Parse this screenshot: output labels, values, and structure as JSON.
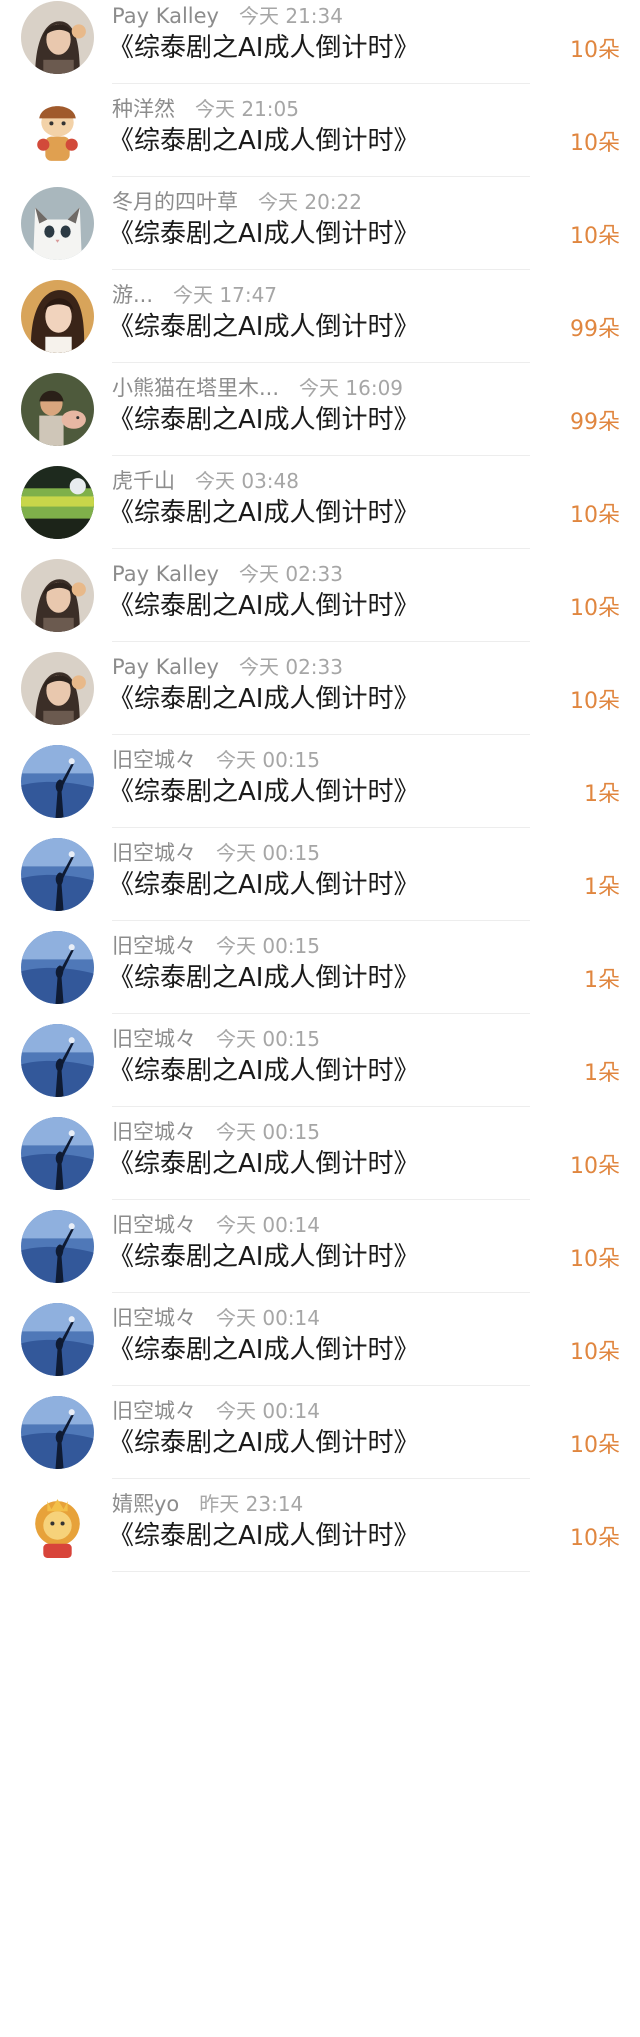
{
  "gift_list": {
    "items": [
      {
        "user": "Pay Kalley",
        "time": "今天 21:34",
        "title": "《综泰剧之AI成人倒计时》",
        "gift": "10朵",
        "avatar_icon": "avatar-girl-icon"
      },
      {
        "user": "种洋然",
        "time": "今天 21:05",
        "title": "《综泰剧之AI成人倒计时》",
        "gift": "10朵",
        "avatar_icon": "avatar-cartoon-icon"
      },
      {
        "user": "冬月的四叶草",
        "time": "今天 20:22",
        "title": "《综泰剧之AI成人倒计时》",
        "gift": "10朵",
        "avatar_icon": "avatar-cat-icon"
      },
      {
        "user": "游...",
        "time": "今天 17:47",
        "title": "《综泰剧之AI成人倒计时》",
        "gift": "99朵",
        "avatar_icon": "avatar-woman-icon"
      },
      {
        "user": "小熊猫在塔里木...",
        "time": "今天 16:09",
        "title": "《综泰剧之AI成人倒计时》",
        "gift": "99朵",
        "avatar_icon": "avatar-child-icon"
      },
      {
        "user": "虎千山",
        "time": "今天 03:48",
        "title": "《综泰剧之AI成人倒计时》",
        "gift": "10朵",
        "avatar_icon": "avatar-landscape-icon"
      },
      {
        "user": "Pay Kalley",
        "time": "今天 02:33",
        "title": "《综泰剧之AI成人倒计时》",
        "gift": "10朵",
        "avatar_icon": "avatar-girl-icon"
      },
      {
        "user": "Pay Kalley",
        "time": "今天 02:33",
        "title": "《综泰剧之AI成人倒计时》",
        "gift": "10朵",
        "avatar_icon": "avatar-girl-icon"
      },
      {
        "user": "旧空城々",
        "time": "今天 00:15",
        "title": "《综泰剧之AI成人倒计时》",
        "gift": "1朵",
        "avatar_icon": "avatar-silhouette-icon"
      },
      {
        "user": "旧空城々",
        "time": "今天 00:15",
        "title": "《综泰剧之AI成人倒计时》",
        "gift": "1朵",
        "avatar_icon": "avatar-silhouette-icon"
      },
      {
        "user": "旧空城々",
        "time": "今天 00:15",
        "title": "《综泰剧之AI成人倒计时》",
        "gift": "1朵",
        "avatar_icon": "avatar-silhouette-icon"
      },
      {
        "user": "旧空城々",
        "time": "今天 00:15",
        "title": "《综泰剧之AI成人倒计时》",
        "gift": "1朵",
        "avatar_icon": "avatar-silhouette-icon"
      },
      {
        "user": "旧空城々",
        "time": "今天 00:15",
        "title": "《综泰剧之AI成人倒计时》",
        "gift": "10朵",
        "avatar_icon": "avatar-silhouette-icon"
      },
      {
        "user": "旧空城々",
        "time": "今天 00:14",
        "title": "《综泰剧之AI成人倒计时》",
        "gift": "10朵",
        "avatar_icon": "avatar-silhouette-icon"
      },
      {
        "user": "旧空城々",
        "time": "今天 00:14",
        "title": "《综泰剧之AI成人倒计时》",
        "gift": "10朵",
        "avatar_icon": "avatar-silhouette-icon"
      },
      {
        "user": "旧空城々",
        "time": "今天 00:14",
        "title": "《综泰剧之AI成人倒计时》",
        "gift": "10朵",
        "avatar_icon": "avatar-silhouette-icon"
      },
      {
        "user": "婧熙yo",
        "time": "昨天 23:14",
        "title": "《综泰剧之AI成人倒计时》",
        "gift": "10朵",
        "avatar_icon": "avatar-lion-icon"
      }
    ]
  },
  "colors": {
    "gift_accent": "#e0863f",
    "name_gray": "#8c8c8c",
    "title_text": "#1a1a1a"
  }
}
